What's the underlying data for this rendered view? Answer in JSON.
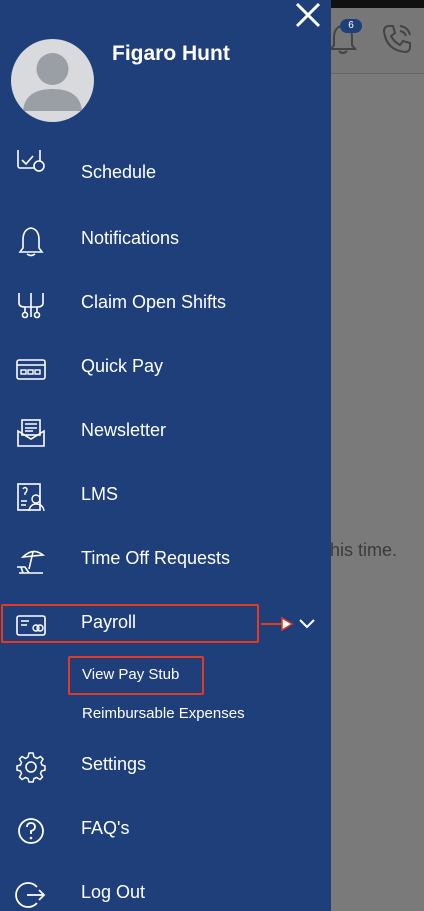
{
  "background": {
    "notification_count": "6",
    "partial_text": "this time."
  },
  "user": {
    "name": "Figaro Hunt"
  },
  "menu": {
    "schedule": "Schedule",
    "notifications": "Notifications",
    "claim_open_shifts": "Claim Open Shifts",
    "quick_pay": "Quick Pay",
    "newsletter": "Newsletter",
    "lms": "LMS",
    "time_off_requests": "Time Off Requests",
    "payroll": "Payroll",
    "view_pay_stub": "View Pay Stub",
    "reimbursable_expenses": "Reimbursable Expenses",
    "settings": "Settings",
    "faqs": "FAQ's",
    "log_out": "Log Out"
  },
  "colors": {
    "drawer_bg": "#1f3f7a",
    "highlight": "#e23b22"
  },
  "icons": [
    "close-icon",
    "avatar-icon",
    "schedule-icon",
    "bell-icon",
    "shifts-icon",
    "card-icon",
    "newsletter-icon",
    "lms-icon",
    "beach-icon",
    "payroll-icon",
    "chevron-down-icon",
    "gear-icon",
    "question-icon",
    "logout-icon",
    "phone-icon"
  ]
}
